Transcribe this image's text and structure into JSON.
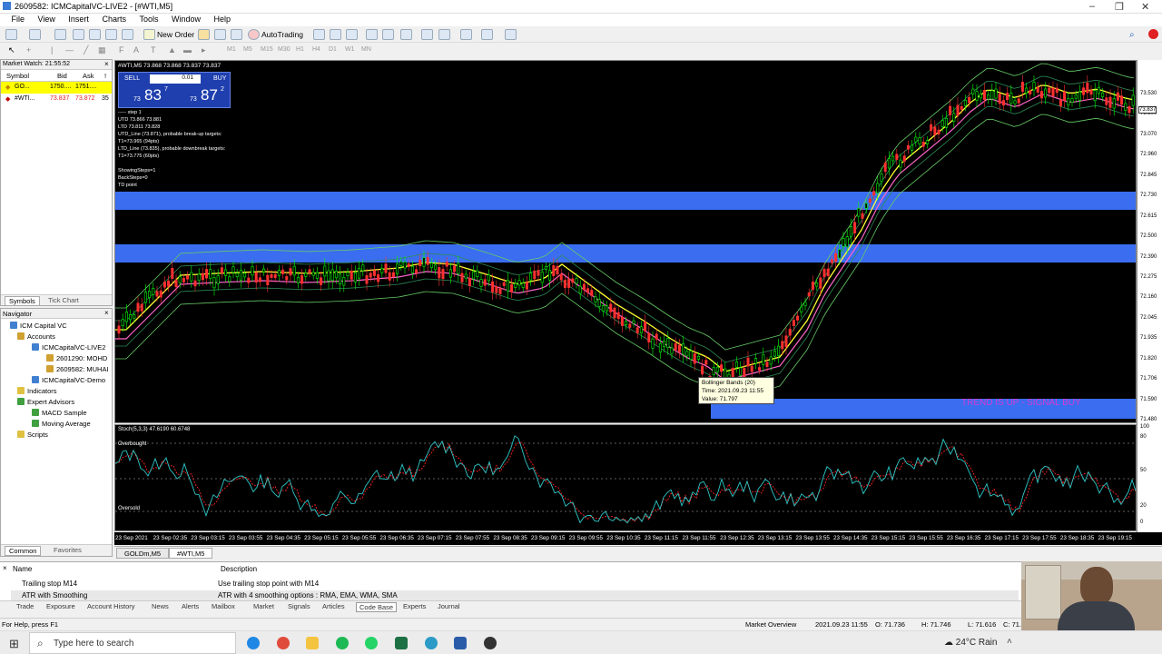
{
  "window": {
    "title": "2609582: ICMCapitalVC-LIVE2 - [#WTI,M5]"
  },
  "menu": [
    "File",
    "View",
    "Insert",
    "Charts",
    "Tools",
    "Window",
    "Help"
  ],
  "toolbar": {
    "new_order": "New Order",
    "autotrading": "AutoTrading"
  },
  "timeframes": [
    "M1",
    "M5",
    "M15",
    "M30",
    "H1",
    "H4",
    "D1",
    "W1",
    "MN"
  ],
  "market_watch": {
    "header": "Market Watch: 21:55:52",
    "columns": [
      "Symbol",
      "Bid",
      "Ask",
      "!"
    ],
    "rows": [
      {
        "symbol": "GO...",
        "bid": "1750....",
        "ask": "1751....",
        "spread": ""
      },
      {
        "symbol": "#WTI...",
        "bid": "73.837",
        "ask": "73.872",
        "spread": "35"
      }
    ],
    "tabs": [
      "Symbols",
      "Tick Chart"
    ]
  },
  "navigator": {
    "header": "Navigator",
    "items": [
      "ICM Capital VC",
      "Accounts",
      "ICMCapitalVC-LIVE2",
      "2601290: MOHD",
      "2609582: MUHAI",
      "ICMCapitalVC-Demo",
      "Indicators",
      "Expert Advisors",
      "MACD Sample",
      "Moving Average",
      "Scripts"
    ]
  },
  "chart": {
    "header": "#WTI,M5  73.868 73.868 73.837 73.837",
    "sell_label": "SELL",
    "buy_label": "BUY",
    "lot": "0.01",
    "sell_price_small": "73",
    "sell_price_big": "83",
    "sell_price_sup": "7",
    "buy_price_small": "73",
    "buy_price_big": "87",
    "buy_price_sup": "2",
    "info_lines": [
      "----- step 1",
      "UTD 73.866  73.881",
      "LTD  73.811  73.828",
      "UTD_Line (73.871), probable break-up targets:",
      "T1=73.965 (94pts)",
      "LTD_Line (73.835), probable downbreak targets:",
      "T1=73.775 (60pts)",
      "",
      "ShowingSteps=1",
      "BackSteps=0",
      "TD point"
    ],
    "tooltip": [
      "Bollinger Bands (20)",
      "Time: 2021.09.23 11:55",
      "Value: 71.797"
    ],
    "signal_text": "TREND IS UP - SIGNAL BUY",
    "price_ticks": [
      "73.530",
      "73.300",
      "73.070",
      "72.960",
      "72.845",
      "72.730",
      "72.615",
      "72.500",
      "72.390",
      "72.275",
      "72.160",
      "72.045",
      "71.935",
      "71.820",
      "71.706",
      "71.590",
      "71.480"
    ],
    "current_price": "73.837"
  },
  "stoch": {
    "header": "Stoch(5,3,3) 47.6190 60.6748",
    "overbought": "Overbought",
    "oversold": "Oversold",
    "ticks": [
      "100",
      "80",
      "50",
      "20",
      "0"
    ]
  },
  "time_axis": [
    "23 Sep 2021",
    "23 Sep 02:35",
    "23 Sep 03:15",
    "23 Sep 03:55",
    "23 Sep 04:35",
    "23 Sep 05:15",
    "23 Sep 05:55",
    "23 Sep 06:35",
    "23 Sep 07:15",
    "23 Sep 07:55",
    "23 Sep 08:35",
    "23 Sep 09:15",
    "23 Sep 09:55",
    "23 Sep 10:35",
    "23 Sep 11:15",
    "23 Sep 11:55",
    "23 Sep 12:35",
    "23 Sep 13:15",
    "23 Sep 13:55",
    "23 Sep 14:35",
    "23 Sep 15:15",
    "23 Sep 15:55",
    "23 Sep 16:35",
    "23 Sep 17:15",
    "23 Sep 17:55",
    "23 Sep 18:35",
    "23 Sep 19:15"
  ],
  "chart_tabs": [
    "GOLDm,M5",
    "#WTI,M5"
  ],
  "terminal": {
    "columns": [
      "Name",
      "Description"
    ],
    "rows": [
      {
        "name": "Trailing stop M14",
        "desc": "Use trailing stop point with M14"
      },
      {
        "name": "ATR with Smoothing",
        "desc": "ATR with 4 smoothing options : RMA, EMA, WMA, SMA"
      }
    ],
    "tabs": [
      "Trade",
      "Exposure",
      "Account History",
      "News",
      "Alerts",
      "Mailbox",
      "Market",
      "Signals",
      "Articles",
      "Code Base",
      "Experts",
      "Journal"
    ]
  },
  "status": {
    "help": "For Help, press F1",
    "profile": "Market Overview",
    "datetime": "2021.09.23 11:55",
    "open": "O: 71.736",
    "high": "H: 71.746",
    "low": "L: 71.616",
    "close": "C: 71."
  },
  "taskbar": {
    "search_placeholder": "Type here to search",
    "weather": "24°C  Rain"
  },
  "colors": {
    "band_blue": "#3a6df0",
    "signal_text": "#d43cd4",
    "bull": "#00ff00",
    "bear": "#ff3030",
    "stoch_main": "#2ec8c8",
    "stoch_signal": "#ff2020"
  }
}
